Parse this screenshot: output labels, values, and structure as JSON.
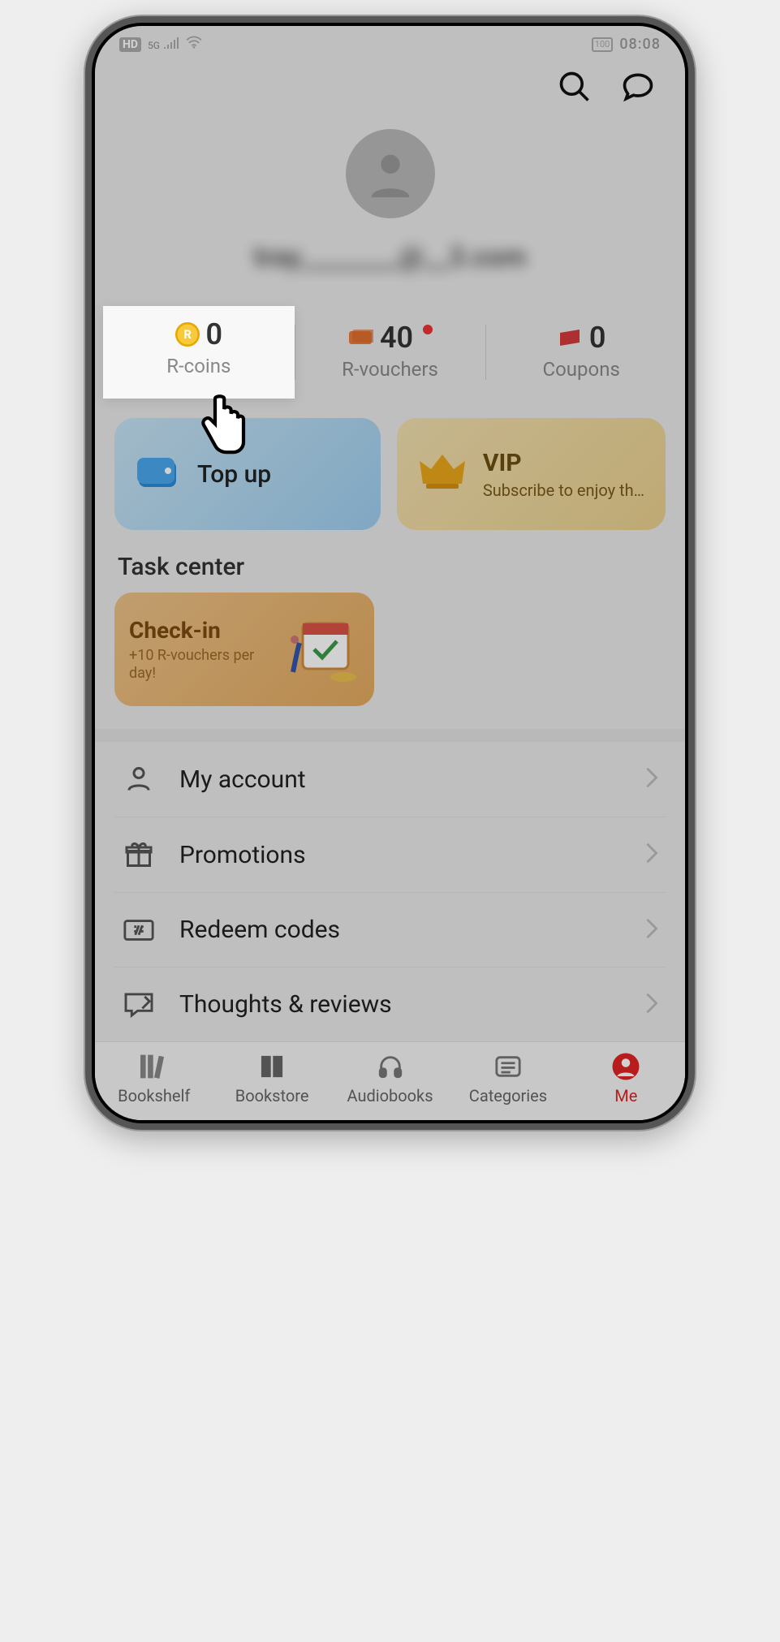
{
  "status": {
    "hd": "HD",
    "net": "5G",
    "battery": "100",
    "time": "08:08"
  },
  "header": {
    "search_icon": "search",
    "chat_icon": "chat"
  },
  "profile": {
    "username_blurred": "tray________@__3.com"
  },
  "currencies": {
    "rcoins": {
      "value": "0",
      "label": "R-coins"
    },
    "rvouchers": {
      "value": "40",
      "label": "R-vouchers",
      "has_dot": true
    },
    "coupons": {
      "value": "0",
      "label": "Coupons"
    }
  },
  "actions": {
    "topup": {
      "title": "Top up"
    },
    "vip": {
      "title": "VIP",
      "subtitle": "Subscribe to enjoy th…"
    }
  },
  "task": {
    "section_label": "Task center",
    "checkin": {
      "title": "Check-in",
      "subtitle": "+10 R-vouchers per day!"
    }
  },
  "menu": [
    {
      "key": "account",
      "label": "My account"
    },
    {
      "key": "promos",
      "label": "Promotions"
    },
    {
      "key": "redeem",
      "label": "Redeem codes"
    },
    {
      "key": "thoughts",
      "label": "Thoughts & reviews"
    }
  ],
  "nav": {
    "bookshelf": "Bookshelf",
    "bookstore": "Bookstore",
    "audiobooks": "Audiobooks",
    "categories": "Categories",
    "me": "Me"
  }
}
